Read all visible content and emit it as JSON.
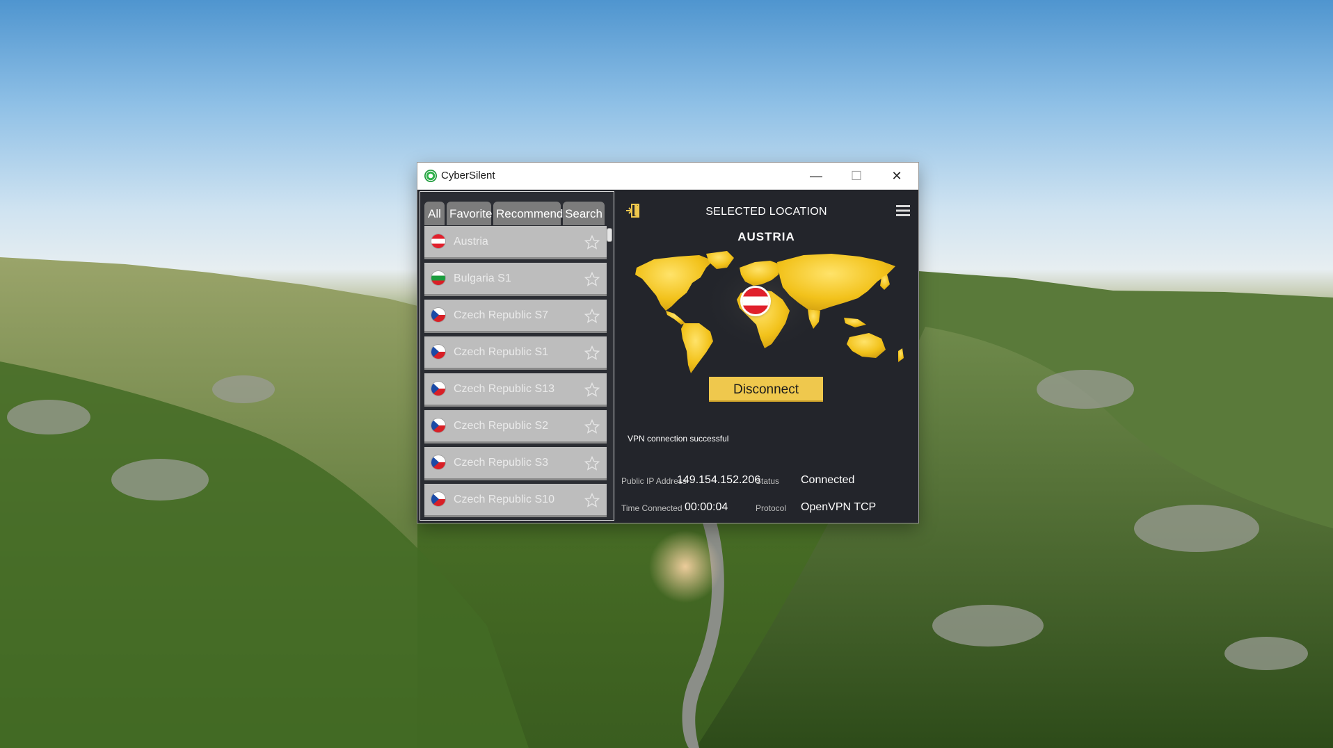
{
  "window": {
    "title": "CyberSilent",
    "minimize_glyph": "—",
    "maximize_glyph": "☐",
    "close_glyph": "✕"
  },
  "tabs": [
    {
      "label": "All"
    },
    {
      "label": "Favorite"
    },
    {
      "label": "Recommend"
    },
    {
      "label": "Search"
    }
  ],
  "servers": [
    {
      "name": "Austria",
      "flag": "austria-flag"
    },
    {
      "name": "Bulgaria S1",
      "flag": "bulgaria-flag"
    },
    {
      "name": "Czech Republic S7",
      "flag": "czech-flag"
    },
    {
      "name": "Czech Republic S1",
      "flag": "czech-flag"
    },
    {
      "name": "Czech Republic S13",
      "flag": "czech-flag"
    },
    {
      "name": "Czech Republic S2",
      "flag": "czech-flag"
    },
    {
      "name": "Czech Republic S3",
      "flag": "czech-flag"
    },
    {
      "name": "Czech Republic S10",
      "flag": "czech-flag"
    }
  ],
  "main": {
    "selected_location_label": "SELECTED LOCATION",
    "country": "AUSTRIA",
    "disconnect_label": "Disconnect",
    "status_message": "VPN connection successful",
    "info": {
      "public_ip_label": "Public IP Address",
      "public_ip": "149.154.152.206",
      "status_label": "Status",
      "status": "Connected",
      "time_label": "Time Connected",
      "time": "00:00:04",
      "protocol_label": "Protocol",
      "protocol": "OpenVPN TCP"
    }
  },
  "colors": {
    "accent": "#efc84d",
    "panel_bg": "#23252b",
    "row_bg": "#bdbdbd",
    "tab_bg": "#7c7c7c",
    "map_gold": "#f2c21b"
  }
}
